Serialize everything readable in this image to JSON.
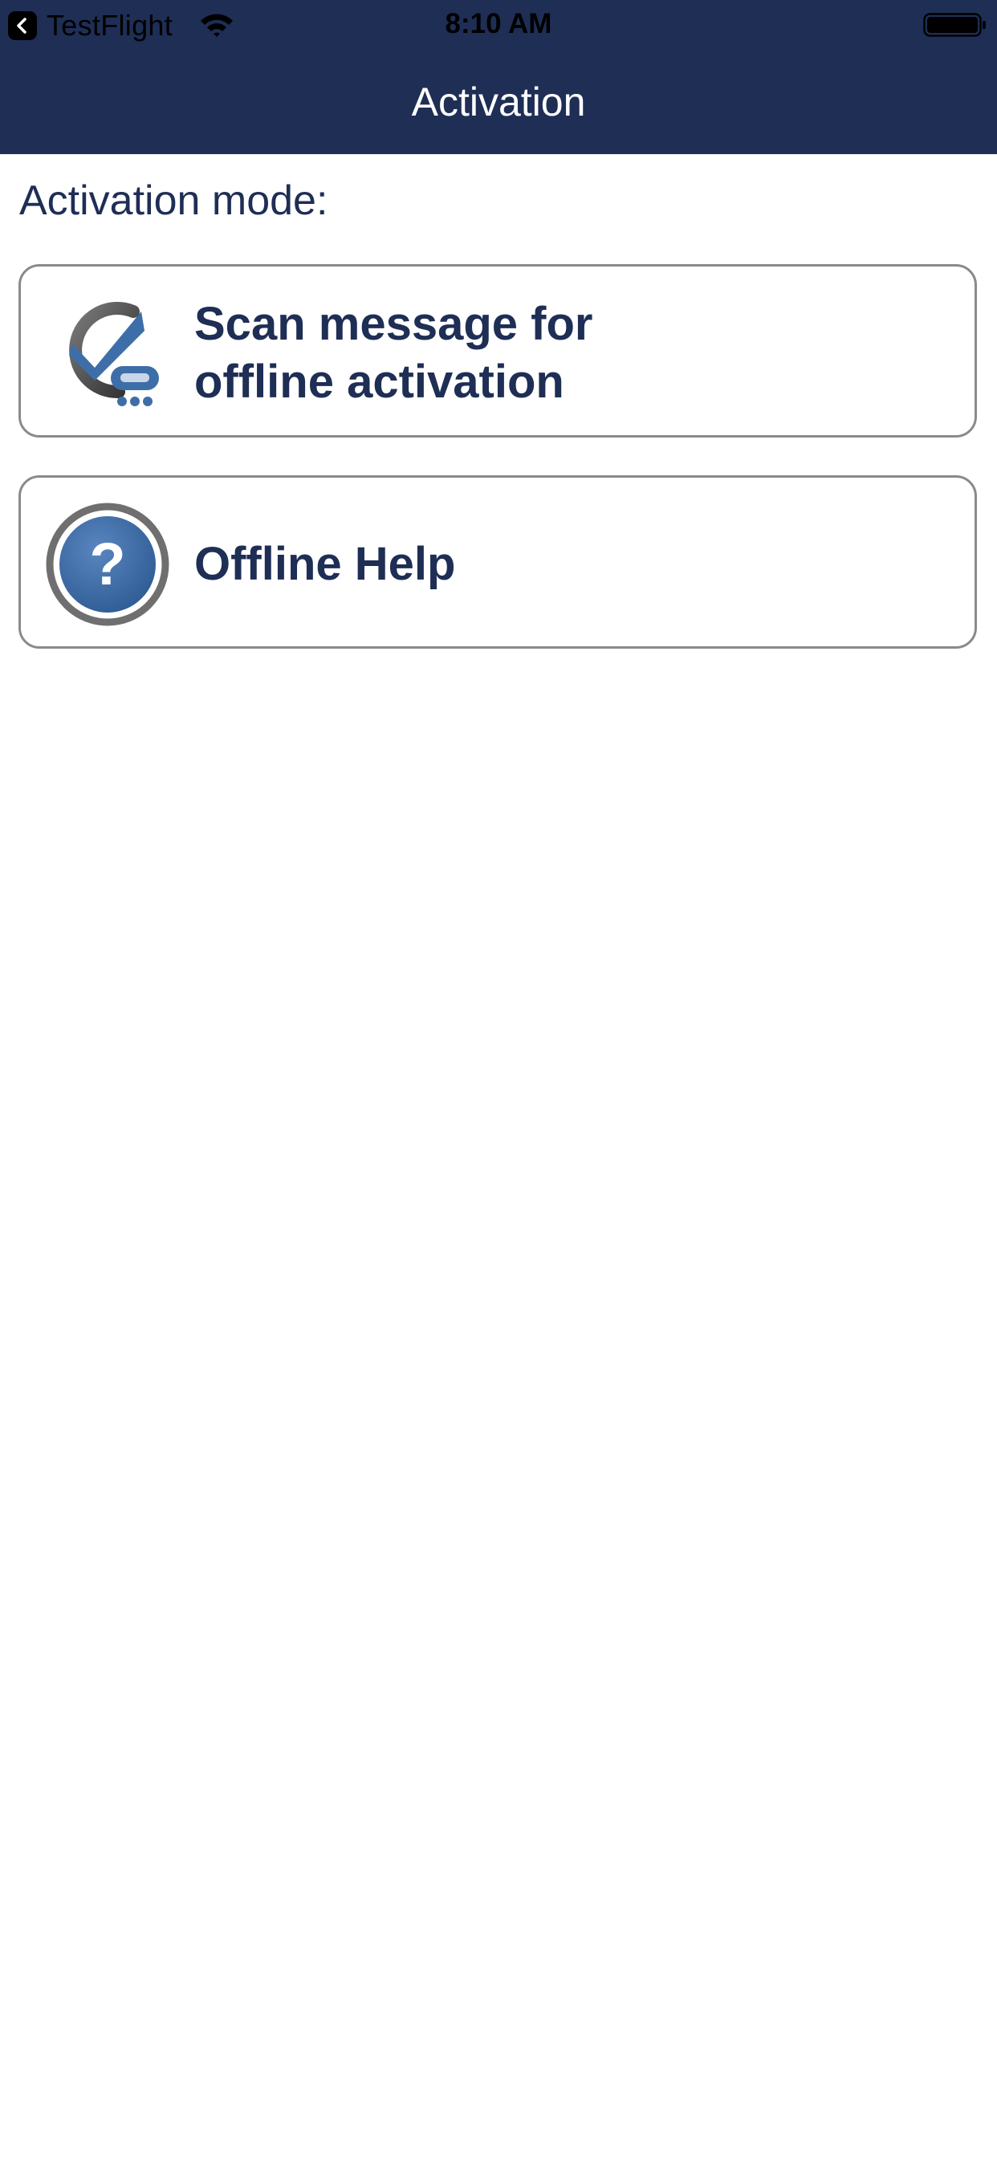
{
  "status_bar": {
    "back_app_label": "TestFlight",
    "time": "8:10 AM"
  },
  "nav": {
    "title": "Activation"
  },
  "content": {
    "section_label": "Activation mode:",
    "options": [
      {
        "label_lines": [
          "Scan message for",
          "offline activation"
        ],
        "icon": "scan-checkmark-icon"
      },
      {
        "label_lines": [
          "Offline Help"
        ],
        "icon": "help-question-icon"
      }
    ]
  },
  "colors": {
    "nav_background": "#1e2e55",
    "text_primary": "#1e2e55",
    "icon_blue": "#3e6ea8",
    "card_border": "#8a8a8a"
  }
}
